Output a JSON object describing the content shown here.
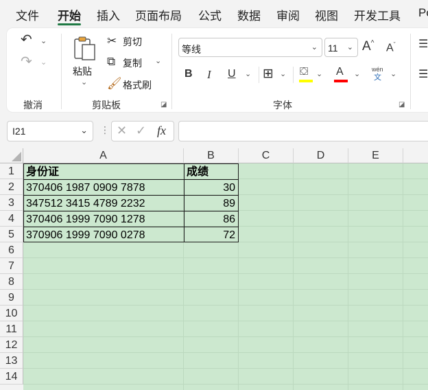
{
  "menu": {
    "tabs": [
      "文件",
      "开始",
      "插入",
      "页面布局",
      "公式",
      "数据",
      "审阅",
      "视图",
      "开发工具",
      "Po"
    ],
    "active_index": 1
  },
  "ribbon": {
    "undo_group_label": "撤消",
    "clipboard": {
      "paste_label": "粘贴",
      "cut_label": "剪切",
      "copy_label": "复制",
      "format_painter_label": "格式刷",
      "group_label": "剪贴板"
    },
    "font": {
      "font_name": "等线",
      "font_size": "11",
      "grow_label": "A",
      "shrink_label": "A",
      "bold_label": "B",
      "italic_label": "I",
      "underline_label": "U",
      "font_color_label": "A",
      "phonetic_top": "wén",
      "phonetic_bottom": "文",
      "group_label": "字体",
      "fill_color": "#ffff00",
      "font_color": "#ff0000"
    }
  },
  "formula_bar": {
    "name_box": "I21",
    "fx_label": "fx",
    "formula": ""
  },
  "grid": {
    "columns": [
      "A",
      "B",
      "C",
      "D",
      "E"
    ],
    "rows": [
      "1",
      "2",
      "3",
      "4",
      "5",
      "6",
      "7",
      "8",
      "9",
      "10",
      "11",
      "12",
      "13",
      "14"
    ],
    "header_row": {
      "a": "身份证",
      "b": "成绩"
    },
    "data_rows": [
      {
        "a": "370406 1987 0909 7878",
        "b": "30"
      },
      {
        "a": "347512 3415 4789 2232",
        "b": "89"
      },
      {
        "a": "370406 1999 7090 1278",
        "b": "86"
      },
      {
        "a": "370906 1999 7090 0278",
        "b": "72"
      }
    ],
    "sheet_background": "#cce8cf"
  }
}
